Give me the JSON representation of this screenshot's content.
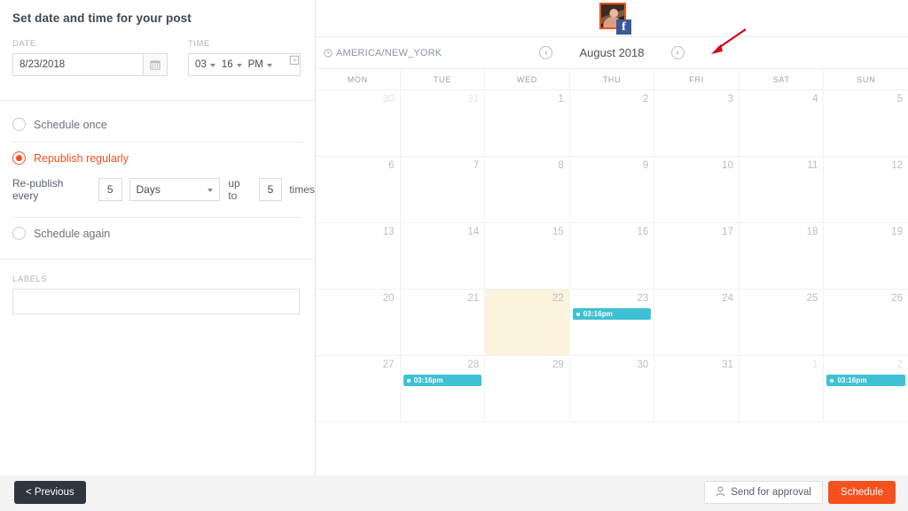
{
  "panel": {
    "title": "Set date and time for your post",
    "date_label": "DATE",
    "date_value": "8/23/2018",
    "date_icon": "calendar-icon",
    "time_label": "TIME",
    "time_hour": "03",
    "time_minute": "16",
    "time_meridiem": "PM",
    "time_icon": "clock-icon",
    "options": [
      {
        "label": "Schedule once",
        "selected": false
      },
      {
        "label": "Republish regularly",
        "selected": true
      },
      {
        "label": "Schedule again",
        "selected": false
      }
    ],
    "republish": {
      "prefix": "Re-publish every",
      "interval": "5",
      "unit": "Days",
      "middle": "up to",
      "count": "5",
      "suffix": "times"
    },
    "labels_label": "LABELS",
    "labels_value": ""
  },
  "calendar": {
    "account": {
      "network": "facebook",
      "badge": "f"
    },
    "timezone": "AMERICA/NEW_YORK",
    "timezone_icon": "clock-icon",
    "prev_label": "‹",
    "next_label": "›",
    "month_title": "August 2018",
    "dow": [
      "MON",
      "TUE",
      "WED",
      "THU",
      "FRI",
      "SAT",
      "SUN"
    ],
    "weeks": [
      [
        {
          "num": "30",
          "out": true
        },
        {
          "num": "31",
          "out": true
        },
        {
          "num": "1",
          "out": false
        },
        {
          "num": "2",
          "out": false
        },
        {
          "num": "3",
          "out": false
        },
        {
          "num": "4",
          "out": false
        },
        {
          "num": "5",
          "out": false
        }
      ],
      [
        {
          "num": "6",
          "out": false
        },
        {
          "num": "7",
          "out": false
        },
        {
          "num": "8",
          "out": false
        },
        {
          "num": "9",
          "out": false
        },
        {
          "num": "10",
          "out": false
        },
        {
          "num": "11",
          "out": false
        },
        {
          "num": "12",
          "out": false
        }
      ],
      [
        {
          "num": "13",
          "out": false
        },
        {
          "num": "14",
          "out": false
        },
        {
          "num": "15",
          "out": false
        },
        {
          "num": "16",
          "out": false
        },
        {
          "num": "17",
          "out": false
        },
        {
          "num": "18",
          "out": false
        },
        {
          "num": "19",
          "out": false
        }
      ],
      [
        {
          "num": "20",
          "out": false
        },
        {
          "num": "21",
          "out": false
        },
        {
          "num": "22",
          "out": false,
          "today": true
        },
        {
          "num": "23",
          "out": false,
          "event": "03:16pm"
        },
        {
          "num": "24",
          "out": false
        },
        {
          "num": "25",
          "out": false
        },
        {
          "num": "26",
          "out": false
        }
      ],
      [
        {
          "num": "27",
          "out": false
        },
        {
          "num": "28",
          "out": false,
          "event": "03:16pm"
        },
        {
          "num": "29",
          "out": false
        },
        {
          "num": "30",
          "out": false
        },
        {
          "num": "31",
          "out": false
        },
        {
          "num": "1",
          "out": true
        },
        {
          "num": "2",
          "out": true,
          "event": "03:16pm"
        }
      ]
    ],
    "annotation": {
      "type": "red-arrow",
      "points_to": "timezone"
    }
  },
  "footer": {
    "previous_label": "< Previous",
    "send_approval_label": "Send for approval",
    "send_approval_icon": "person-icon",
    "schedule_label": "Schedule"
  },
  "colors": {
    "accent": "#f4511e",
    "event": "#3ec1d3",
    "today": "#fcf3dd",
    "facebook": "#3b5998",
    "dark": "#2f3640"
  }
}
